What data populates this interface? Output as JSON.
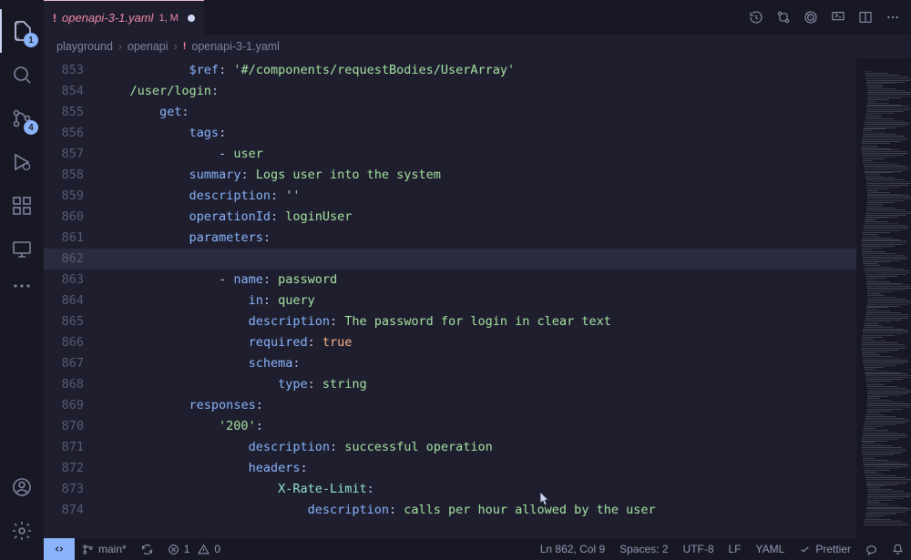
{
  "activityBar": {
    "explorerBadge": "1",
    "scmBadge": "4"
  },
  "tab": {
    "iconGlyph": "!",
    "name": "openapi-3-1.yaml",
    "problems": "1, M"
  },
  "breadcrumbs": {
    "seg1": "playground",
    "seg2": "openapi",
    "iconGlyph": "!",
    "seg3": "openapi-3-1.yaml"
  },
  "gutterStart": 853,
  "code": {
    "lines": [
      {
        "indent": 6,
        "segs": [
          {
            "t": "$ref",
            "c": "k"
          },
          {
            "t": ": ",
            "c": "d"
          },
          {
            "t": "'#/components/requestBodies/UserArray'",
            "c": "s"
          }
        ]
      },
      {
        "indent": 2,
        "segs": [
          {
            "t": "/user/login",
            "c": "s"
          },
          {
            "t": ":",
            "c": "d"
          }
        ]
      },
      {
        "indent": 4,
        "segs": [
          {
            "t": "get",
            "c": "k"
          },
          {
            "t": ":",
            "c": "d"
          }
        ]
      },
      {
        "indent": 6,
        "segs": [
          {
            "t": "tags",
            "c": "k"
          },
          {
            "t": ":",
            "c": "d"
          }
        ]
      },
      {
        "indent": 8,
        "segs": [
          {
            "t": "- ",
            "c": "d"
          },
          {
            "t": "user",
            "c": "s"
          }
        ]
      },
      {
        "indent": 6,
        "segs": [
          {
            "t": "summary",
            "c": "k"
          },
          {
            "t": ": ",
            "c": "d"
          },
          {
            "t": "Logs user into the system",
            "c": "s"
          }
        ]
      },
      {
        "indent": 6,
        "segs": [
          {
            "t": "description",
            "c": "k"
          },
          {
            "t": ": ",
            "c": "d"
          },
          {
            "t": "''",
            "c": "s"
          }
        ]
      },
      {
        "indent": 6,
        "segs": [
          {
            "t": "operationId",
            "c": "k"
          },
          {
            "t": ": ",
            "c": "d"
          },
          {
            "t": "loginUser",
            "c": "s"
          }
        ]
      },
      {
        "indent": 6,
        "segs": [
          {
            "t": "parameters",
            "c": "k"
          },
          {
            "t": ":",
            "c": "d"
          }
        ]
      },
      {
        "indent": 0,
        "segs": [],
        "highlight": true
      },
      {
        "indent": 8,
        "segs": [
          {
            "t": "- ",
            "c": "d"
          },
          {
            "t": "name",
            "c": "k"
          },
          {
            "t": ": ",
            "c": "d"
          },
          {
            "t": "password",
            "c": "s"
          }
        ]
      },
      {
        "indent": 10,
        "segs": [
          {
            "t": "in",
            "c": "k"
          },
          {
            "t": ": ",
            "c": "d"
          },
          {
            "t": "query",
            "c": "s"
          }
        ]
      },
      {
        "indent": 10,
        "segs": [
          {
            "t": "description",
            "c": "k"
          },
          {
            "t": ": ",
            "c": "d"
          },
          {
            "t": "The password for login in clear text",
            "c": "s"
          }
        ]
      },
      {
        "indent": 10,
        "segs": [
          {
            "t": "required",
            "c": "k"
          },
          {
            "t": ": ",
            "c": "d"
          },
          {
            "t": "true",
            "c": "b"
          }
        ]
      },
      {
        "indent": 10,
        "segs": [
          {
            "t": "schema",
            "c": "k"
          },
          {
            "t": ":",
            "c": "d"
          }
        ]
      },
      {
        "indent": 12,
        "segs": [
          {
            "t": "type",
            "c": "k"
          },
          {
            "t": ": ",
            "c": "d"
          },
          {
            "t": "string",
            "c": "s"
          }
        ]
      },
      {
        "indent": 6,
        "segs": [
          {
            "t": "responses",
            "c": "k"
          },
          {
            "t": ":",
            "c": "d"
          }
        ]
      },
      {
        "indent": 8,
        "segs": [
          {
            "t": "'200'",
            "c": "s"
          },
          {
            "t": ":",
            "c": "d"
          }
        ]
      },
      {
        "indent": 10,
        "segs": [
          {
            "t": "description",
            "c": "k"
          },
          {
            "t": ": ",
            "c": "d"
          },
          {
            "t": "successful operation",
            "c": "s"
          }
        ]
      },
      {
        "indent": 10,
        "segs": [
          {
            "t": "headers",
            "c": "k"
          },
          {
            "t": ":",
            "c": "d"
          }
        ]
      },
      {
        "indent": 12,
        "segs": [
          {
            "t": "X-Rate-Limit",
            "c": "p"
          },
          {
            "t": ":",
            "c": "d"
          }
        ]
      },
      {
        "indent": 14,
        "segs": [
          {
            "t": "description",
            "c": "k"
          },
          {
            "t": ": ",
            "c": "d"
          },
          {
            "t": "calls per hour allowed by the user",
            "c": "s"
          }
        ]
      }
    ]
  },
  "status": {
    "branch": "main*",
    "errors": "1",
    "warnings": "0",
    "lncol": "Ln 862, Col 9",
    "spaces": "Spaces: 2",
    "encoding": "UTF-8",
    "eol": "LF",
    "language": "YAML",
    "prettier": "Prettier"
  }
}
